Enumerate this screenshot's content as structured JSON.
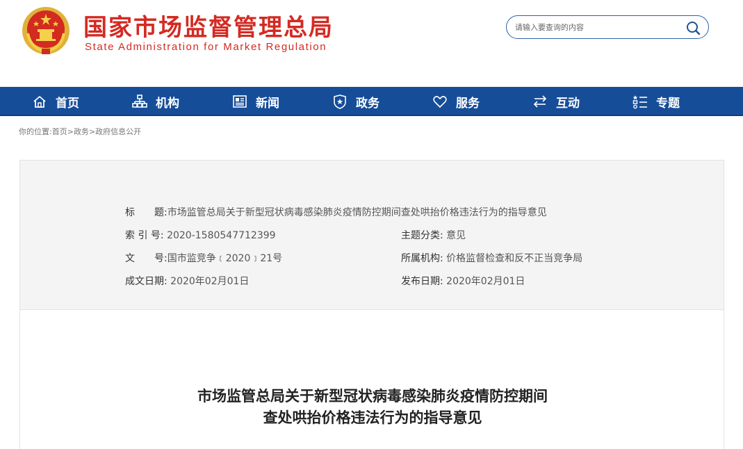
{
  "header": {
    "title": "国家市场监督管理总局",
    "subtitle": "State Administration for Market Regulation",
    "search_placeholder": "请输入要查询的内容"
  },
  "nav": {
    "items": [
      {
        "label": "首页",
        "icon": "home-icon"
      },
      {
        "label": "机构",
        "icon": "org-chart-icon"
      },
      {
        "label": "新闻",
        "icon": "newspaper-icon"
      },
      {
        "label": "政务",
        "icon": "shield-star-icon"
      },
      {
        "label": "服务",
        "icon": "heart-icon"
      },
      {
        "label": "互动",
        "icon": "exchange-arrows-icon"
      },
      {
        "label": "专题",
        "icon": "list-icon"
      }
    ]
  },
  "breadcrumb": {
    "prefix": "你的位置:",
    "links": [
      "首页",
      "政务",
      "政府信息公开"
    ],
    "separator": ">"
  },
  "info": {
    "title_label": "标　　题:",
    "title_value": "市场监管总局关于新型冠状病毒感染肺炎疫情防控期间查处哄抬价格违法行为的指导意见",
    "index_label": "索 引 号:",
    "index_value": "2020-1580547712399",
    "topic_label": "主题分类:",
    "topic_value": "意见",
    "doc_label": "文　　号:",
    "doc_value": "国市监竞争﹝2020﹞21号",
    "org_label": "所属机构:",
    "org_value": "价格监督检查和反不正当竞争局",
    "created_label": "成文日期:",
    "created_value": "2020年02月01日",
    "published_label": "发布日期:",
    "published_value": "2020年02月01日"
  },
  "article": {
    "title_line1": "市场监管总局关于新型冠状病毒感染肺炎疫情防控期间",
    "title_line2": "查处哄抬价格违法行为的指导意见"
  },
  "colors": {
    "brand_red": "#d42a22",
    "nav_blue": "#164d98",
    "info_bg": "#f4f4f4"
  }
}
